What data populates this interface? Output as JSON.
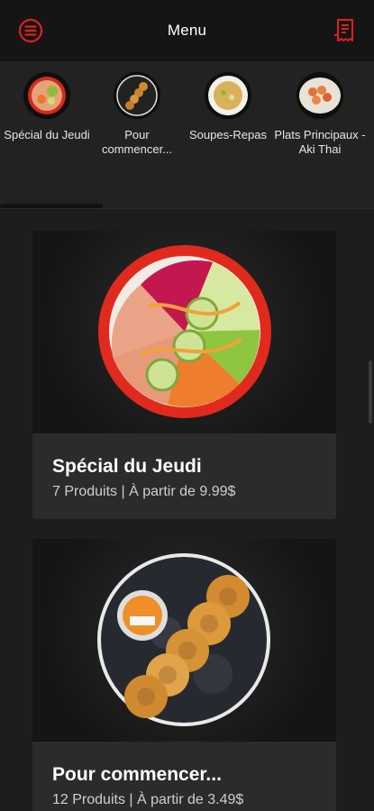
{
  "header": {
    "title": "Menu",
    "accent_color": "#e0201f"
  },
  "categories": [
    {
      "label": "Spécial du Jeudi",
      "icon": "poke-bowl"
    },
    {
      "label": "Pour commencer...",
      "icon": "croquettes-plate"
    },
    {
      "label": "Soupes-Repas",
      "icon": "soup-bowl"
    },
    {
      "label": "Plats Principaux - Aki Thai",
      "icon": "shrimp-dish"
    }
  ],
  "cards": [
    {
      "name": "Spécial du Jeudi",
      "meta": "7 Produits | À partir de 9.99$"
    },
    {
      "name": "Pour commencer...",
      "meta": "12 Produits | À partir de 3.49$"
    }
  ]
}
